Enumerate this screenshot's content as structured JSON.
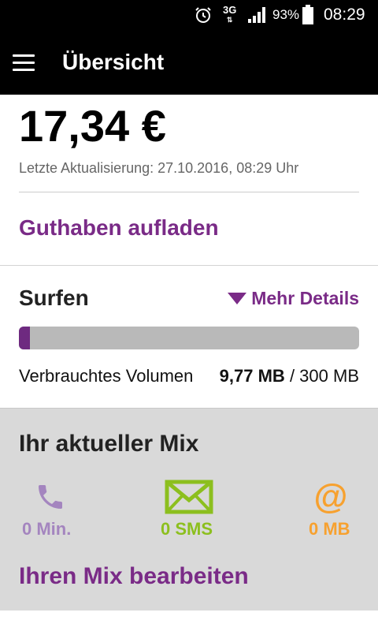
{
  "status_bar": {
    "network": "3G",
    "battery": "93%",
    "time": "08:29",
    "icons": [
      "alarm-icon",
      "signal-icon",
      "battery-icon"
    ]
  },
  "header": {
    "title": "Übersicht",
    "menu_icon": "hamburger-menu-icon"
  },
  "balance": {
    "amount": "17,34 €",
    "last_update": "Letzte Aktualisierung: 27.10.2016, 08:29 Uhr",
    "topup_label": "Guthaben aufladen"
  },
  "surfen": {
    "title": "Surfen",
    "more_details": "Mehr Details",
    "used_label": "Verbrauchtes Volumen",
    "used_value": "9,77 MB",
    "total": "/ 300 MB",
    "progress": 0.0326
  },
  "mix": {
    "title": "Ihr aktueller Mix",
    "items": [
      {
        "value": "0 Min.",
        "icon": "phone-icon",
        "color": "#a485bf"
      },
      {
        "value": "0 SMS",
        "icon": "envelope-icon",
        "color": "#8cbf1e"
      },
      {
        "value": "0 MB",
        "icon": "at-icon",
        "color": "#f7a12f"
      }
    ],
    "edit_label": "Ihren Mix bearbeiten"
  },
  "colors": {
    "accent": "#7a2b87",
    "progress_fill": "#6e2a80",
    "progress_track": "#b9b9b9",
    "mix_background": "#d9d9d9"
  }
}
